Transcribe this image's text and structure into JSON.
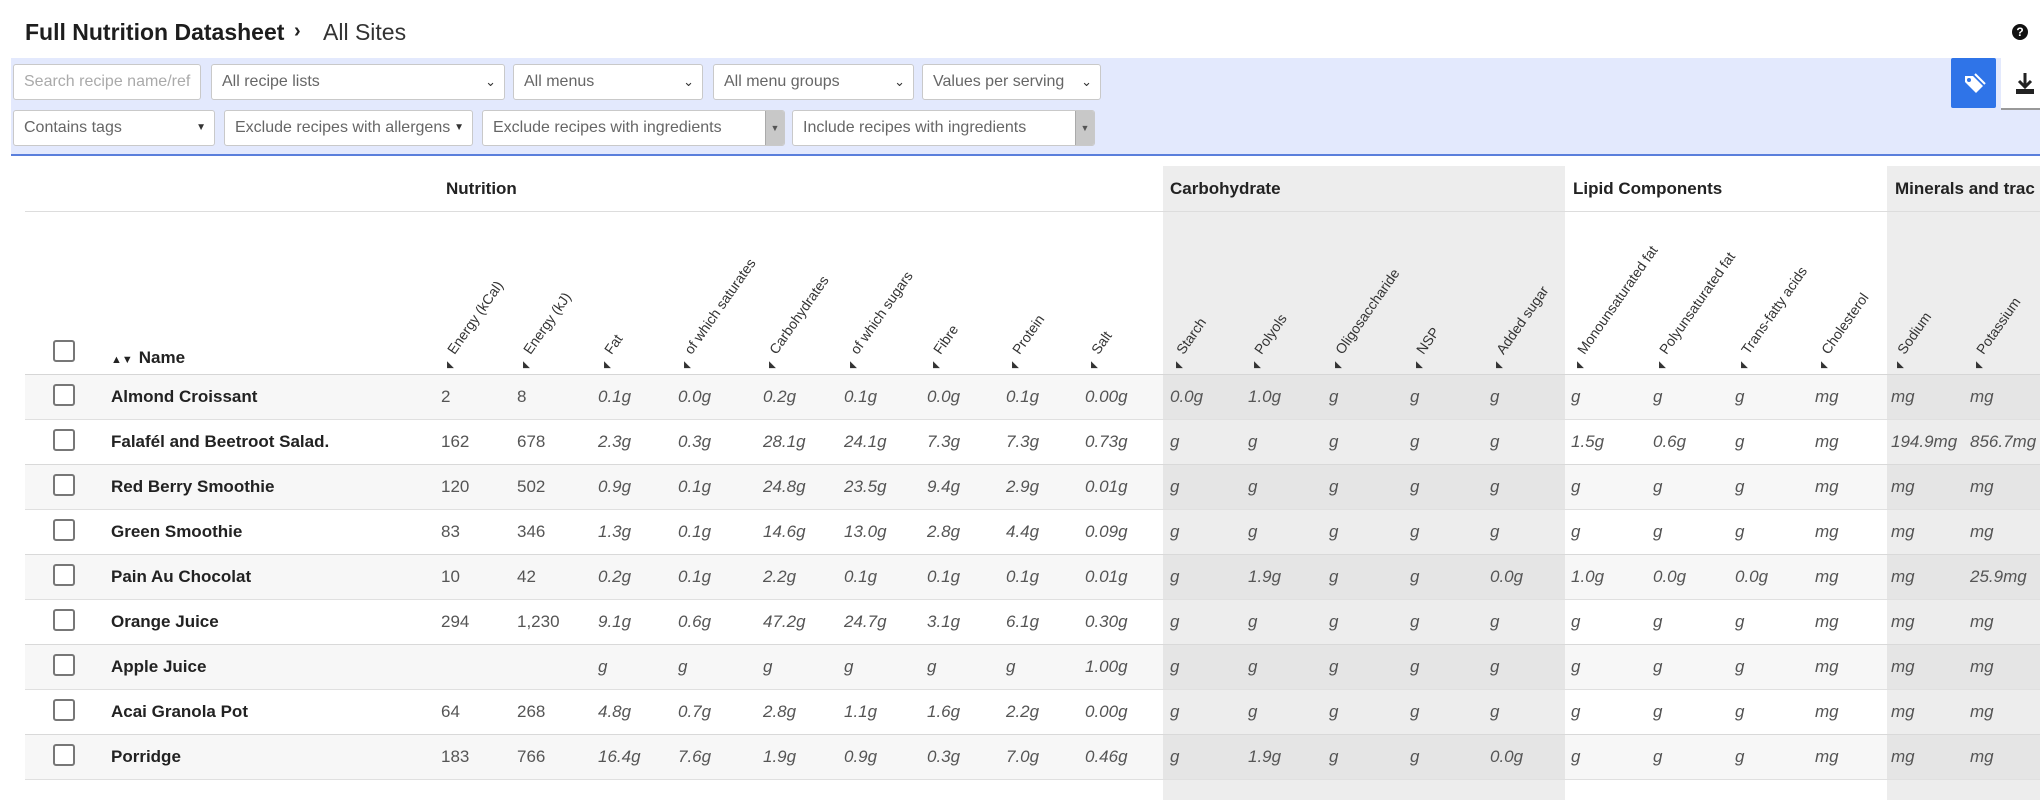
{
  "header": {
    "title": "Full Nutrition Datasheet",
    "separator": "›",
    "site": "All Sites",
    "help_icon": "?"
  },
  "filters": {
    "search_placeholder": "Search recipe name/ref",
    "recipe_lists": "All recipe lists",
    "menus": "All menus",
    "menu_groups": "All menu groups",
    "values_mode": "Values per serving",
    "contains_tags": "Contains tags",
    "exclude_allergens": "Exclude recipes with allergens",
    "exclude_ingredients": "Exclude recipes with ingredients",
    "include_ingredients": "Include recipes with ingredients",
    "tag_icon": "tag-icon",
    "download_icon": "download-icon"
  },
  "colors": {
    "accent": "#2f74e8",
    "filter_bg": "#e3e9fd",
    "group_band": "#ededed"
  },
  "table": {
    "name_header": "Name",
    "groups": [
      "Nutrition",
      "Carbohydrate",
      "Lipid Components",
      "Minerals and trac"
    ],
    "columns": [
      "Energy (kCal)",
      "Energy (kJ)",
      "Fat",
      "of which saturates",
      "Carbohydrates",
      "of which sugars",
      "Fibre",
      "Protein",
      "Salt",
      "Starch",
      "Polyols",
      "Oligosaccharide",
      "NSP",
      "Added sugar",
      "Monounsaturated fat",
      "Polyunsaturated fat",
      "Trans-fatty acids",
      "Cholesterol",
      "Sodium",
      "Potassium"
    ],
    "rows": [
      {
        "name": "Almond Croissant",
        "values": [
          "2",
          "8",
          "0.1g",
          "0.0g",
          "0.2g",
          "0.1g",
          "0.0g",
          "0.1g",
          "0.00g",
          "0.0g",
          "1.0g",
          "g",
          "g",
          "g",
          "g",
          "g",
          "g",
          "mg",
          "mg",
          "mg"
        ]
      },
      {
        "name": "Falafél and Beetroot Salad.",
        "values": [
          "162",
          "678",
          "2.3g",
          "0.3g",
          "28.1g",
          "24.1g",
          "7.3g",
          "7.3g",
          "0.73g",
          "g",
          "g",
          "g",
          "g",
          "g",
          "1.5g",
          "0.6g",
          "g",
          "mg",
          "194.9mg",
          "856.7mg"
        ]
      },
      {
        "name": "Red Berry Smoothie",
        "values": [
          "120",
          "502",
          "0.9g",
          "0.1g",
          "24.8g",
          "23.5g",
          "9.4g",
          "2.9g",
          "0.01g",
          "g",
          "g",
          "g",
          "g",
          "g",
          "g",
          "g",
          "g",
          "mg",
          "mg",
          "mg"
        ]
      },
      {
        "name": "Green Smoothie",
        "values": [
          "83",
          "346",
          "1.3g",
          "0.1g",
          "14.6g",
          "13.0g",
          "2.8g",
          "4.4g",
          "0.09g",
          "g",
          "g",
          "g",
          "g",
          "g",
          "g",
          "g",
          "g",
          "mg",
          "mg",
          "mg"
        ]
      },
      {
        "name": "Pain Au Chocolat",
        "values": [
          "10",
          "42",
          "0.2g",
          "0.1g",
          "2.2g",
          "0.1g",
          "0.1g",
          "0.1g",
          "0.01g",
          "g",
          "1.9g",
          "g",
          "g",
          "0.0g",
          "1.0g",
          "0.0g",
          "0.0g",
          "mg",
          "mg",
          "25.9mg"
        ]
      },
      {
        "name": "Orange Juice",
        "values": [
          "294",
          "1,230",
          "9.1g",
          "0.6g",
          "47.2g",
          "24.7g",
          "3.1g",
          "6.1g",
          "0.30g",
          "g",
          "g",
          "g",
          "g",
          "g",
          "g",
          "g",
          "g",
          "mg",
          "mg",
          "mg"
        ]
      },
      {
        "name": "Apple Juice",
        "values": [
          "",
          "",
          "g",
          "g",
          "g",
          "g",
          "g",
          "g",
          "1.00g",
          "g",
          "g",
          "g",
          "g",
          "g",
          "g",
          "g",
          "g",
          "mg",
          "mg",
          "mg"
        ]
      },
      {
        "name": "Acai Granola Pot",
        "values": [
          "64",
          "268",
          "4.8g",
          "0.7g",
          "2.8g",
          "1.1g",
          "1.6g",
          "2.2g",
          "0.00g",
          "g",
          "g",
          "g",
          "g",
          "g",
          "g",
          "g",
          "g",
          "mg",
          "mg",
          "mg"
        ]
      },
      {
        "name": "Porridge",
        "values": [
          "183",
          "766",
          "16.4g",
          "7.6g",
          "1.9g",
          "0.9g",
          "0.3g",
          "7.0g",
          "0.46g",
          "g",
          "1.9g",
          "g",
          "g",
          "0.0g",
          "g",
          "g",
          "g",
          "mg",
          "mg",
          "mg"
        ]
      }
    ]
  }
}
